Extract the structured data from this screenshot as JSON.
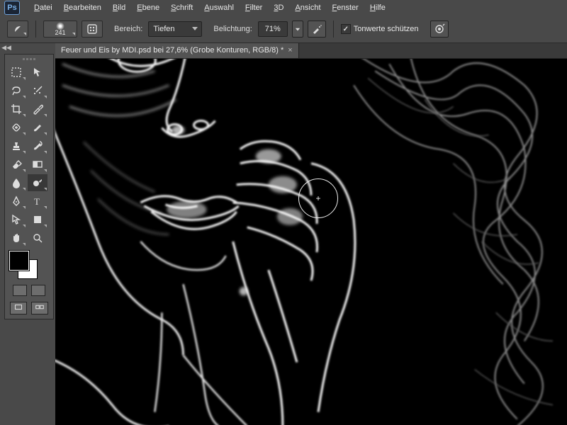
{
  "app": {
    "logo": "Ps"
  },
  "menu": {
    "items": [
      {
        "label": "Datei",
        "ul": "D",
        "rest": "atei"
      },
      {
        "label": "Bearbeiten",
        "ul": "B",
        "rest": "earbeiten"
      },
      {
        "label": "Bild",
        "ul": "B",
        "rest": "ild"
      },
      {
        "label": "Ebene",
        "ul": "E",
        "rest": "bene"
      },
      {
        "label": "Schrift",
        "ul": "S",
        "rest": "chrift"
      },
      {
        "label": "Auswahl",
        "ul": "A",
        "rest": "uswahl"
      },
      {
        "label": "Filter",
        "ul": "F",
        "rest": "ilter"
      },
      {
        "label": "3D",
        "ul": "3",
        "rest": "D"
      },
      {
        "label": "Ansicht",
        "ul": "A",
        "rest": "nsicht"
      },
      {
        "label": "Fenster",
        "ul": "F",
        "rest": "enster"
      },
      {
        "label": "Hilfe",
        "ul": "H",
        "rest": "ilfe"
      }
    ]
  },
  "options": {
    "brush_size": "241",
    "range_label": "Bereich:",
    "range_value": "Tiefen",
    "exposure_label": "Belichtung:",
    "exposure_value": "71%",
    "protect_tones_checked": true,
    "protect_tones_label": "Tonwerte schützen"
  },
  "document": {
    "tab_title": "Feuer und Eis by MDI.psd bei 27,6% (Grobe Konturen, RGB/8) *"
  },
  "tools": {
    "names": [
      [
        "marquee",
        "move"
      ],
      [
        "lasso",
        "magic-wand"
      ],
      [
        "crop",
        "eyedropper"
      ],
      [
        "healing",
        "brush"
      ],
      [
        "stamp",
        "history-brush"
      ],
      [
        "eraser",
        "gradient"
      ],
      [
        "blur",
        "dodge"
      ],
      [
        "pen",
        "type"
      ],
      [
        "path-select",
        "shape"
      ],
      [
        "hand",
        "zoom"
      ]
    ],
    "active": "dodge",
    "fg_color": "#000000",
    "bg_color": "#ffffff"
  },
  "cursor": {
    "symbol": "+"
  }
}
